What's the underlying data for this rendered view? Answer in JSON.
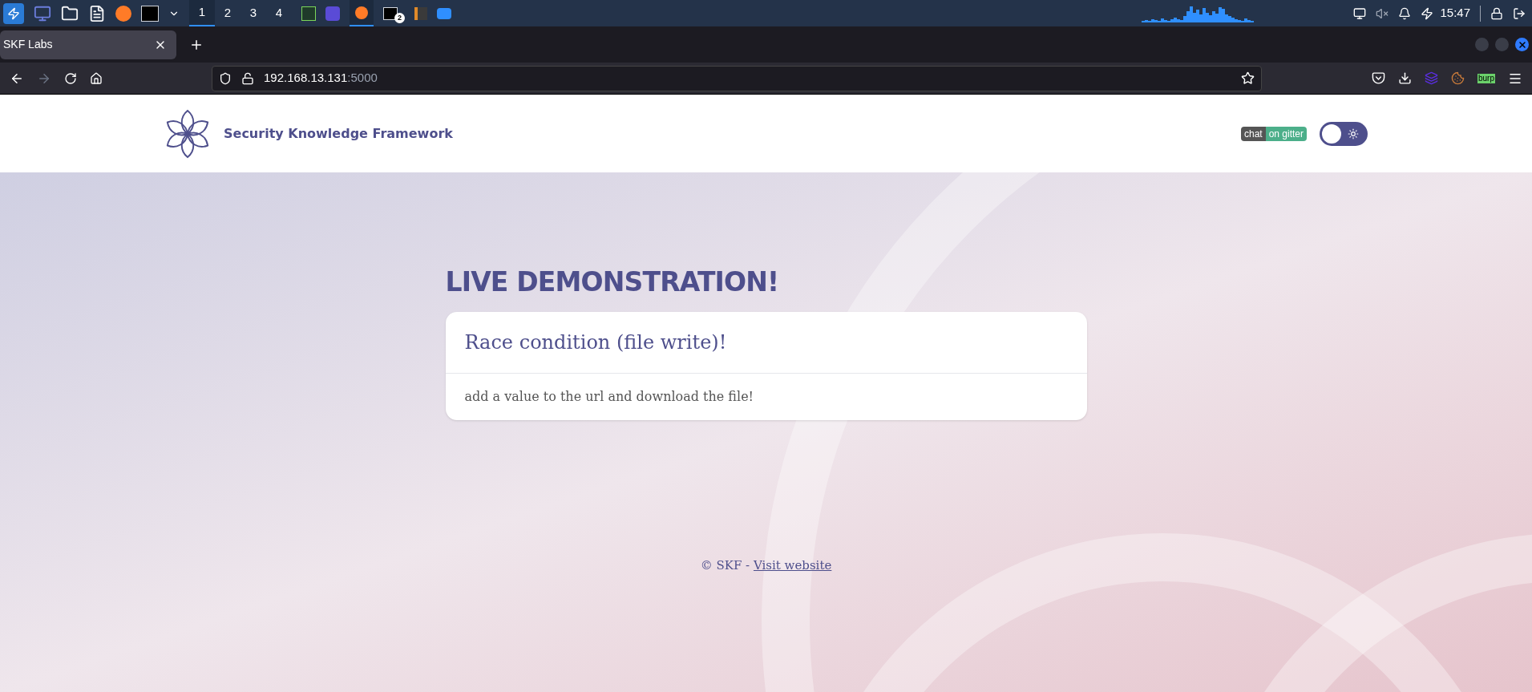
{
  "taskbar": {
    "workspaces": [
      {
        "label": "1",
        "selected": true
      },
      {
        "label": "2",
        "selected": false
      },
      {
        "label": "3",
        "selected": false
      },
      {
        "label": "4",
        "selected": false
      }
    ],
    "terminal_badge": "2",
    "clock": "15:47"
  },
  "browser": {
    "tab": {
      "title": "SKF Labs",
      "selected": true
    },
    "url": {
      "host": "192.168.13.131",
      "port": ":5000"
    },
    "burp_label": "burp"
  },
  "site_header": {
    "title": "Security Knowledge Framework",
    "badge": {
      "left": "chat",
      "right": "on gitter"
    },
    "theme_toggle": {
      "on": false
    }
  },
  "main": {
    "heading": "LIVE DEMONSTRATION!",
    "card": {
      "title": "Race condition (file write)!",
      "body": "add a value to the url and download the file!"
    }
  },
  "footer": {
    "text": "© SKF - ",
    "link": "Visit website"
  }
}
